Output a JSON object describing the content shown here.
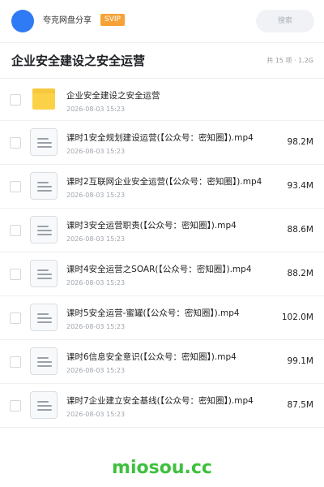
{
  "header": {
    "app_name": "夸克网盘分享",
    "badge": "SVIP",
    "search_placeholder": "搜索",
    "avatar_color": "#2f7bf6"
  },
  "title_bar": {
    "title": "企业安全建设之安全运营",
    "summary": "共 15 项 · 1.2G"
  },
  "files": [
    {
      "type": "folder",
      "name": "企业安全建设之安全运营",
      "date": "2026-08-03 15:23",
      "size": ""
    },
    {
      "type": "file",
      "name": "课时1安全规划建设运营(【公众号：密知圈】).mp4",
      "date": "2026-08-03 15:23",
      "size": "98.2M"
    },
    {
      "type": "file",
      "name": "课时2互联网企业安全运营(【公众号：密知圈】).mp4",
      "date": "2026-08-03 15:23",
      "size": "93.4M"
    },
    {
      "type": "file",
      "name": "课时3安全运营职责(【公众号：密知圈】).mp4",
      "date": "2026-08-03 15:23",
      "size": "88.6M"
    },
    {
      "type": "file",
      "name": "课时4安全运营之SOAR(【公众号：密知圈】).mp4",
      "date": "2026-08-03 15:23",
      "size": "88.2M"
    },
    {
      "type": "file",
      "name": "课时5安全运营-蜜罐(【公众号：密知圈】).mp4",
      "date": "2026-08-03 15:23",
      "size": "102.0M"
    },
    {
      "type": "file",
      "name": "课时6信息安全意识(【公众号：密知圈】).mp4",
      "date": "2026-08-03 15:23",
      "size": "99.1M"
    },
    {
      "type": "file",
      "name": "课时7企业建立安全基线(【公众号：密知圈】).mp4",
      "date": "2026-08-03 15:23",
      "size": "87.5M"
    }
  ],
  "watermark": "miosou.cc",
  "colors": {
    "badge": "#f7a238",
    "folder": "#fbd247",
    "watermark": "#3ec03e"
  }
}
